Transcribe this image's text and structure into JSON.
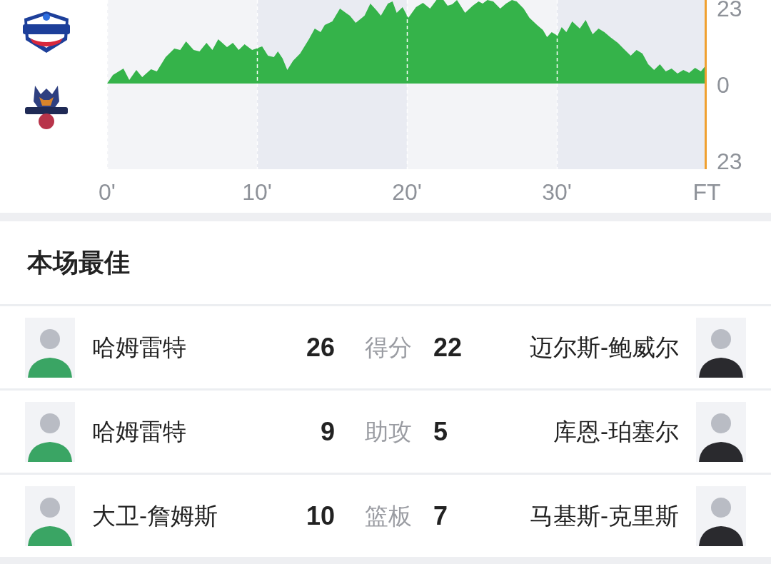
{
  "chart": {
    "y_labels": [
      "23",
      "0",
      "23"
    ],
    "x_labels": [
      "0'",
      "10'",
      "20'",
      "30'",
      "FT"
    ]
  },
  "section_title": "本场最佳",
  "leaders": [
    {
      "left_player": "哈姆雷特",
      "left_value": "26",
      "stat": "得分",
      "right_value": "22",
      "right_player": "迈尔斯-鲍威尔"
    },
    {
      "left_player": "哈姆雷特",
      "left_value": "9",
      "stat": "助攻",
      "right_value": "5",
      "right_player": "库恩-珀塞尔"
    },
    {
      "left_player": "大卫-詹姆斯",
      "left_value": "10",
      "stat": "篮板",
      "right_value": "7",
      "right_player": "马基斯-克里斯"
    }
  ]
}
